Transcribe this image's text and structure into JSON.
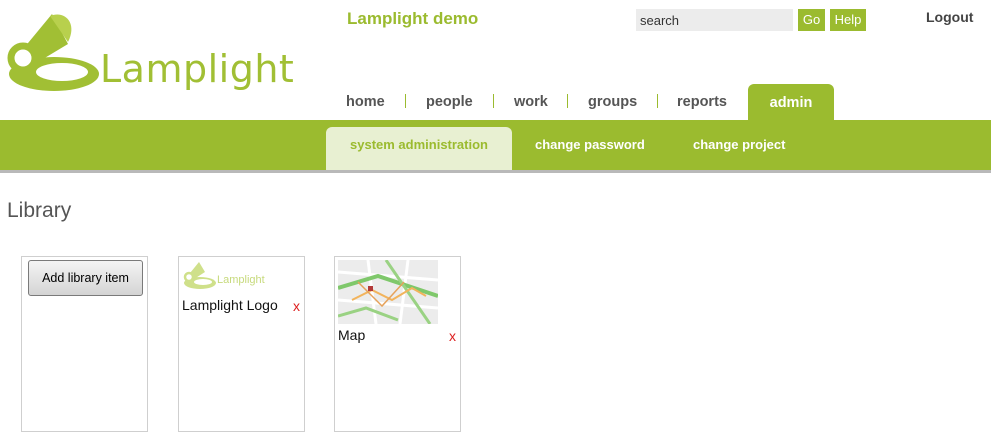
{
  "header": {
    "logo_text": "Lamplight",
    "app_title": "Lamplight demo",
    "search": {
      "placeholder": "search",
      "go_label": "Go"
    },
    "help_label": "Help",
    "logout_label": "Logout",
    "brand_color": "#9bbb2f"
  },
  "nav": {
    "items": [
      {
        "label": "home"
      },
      {
        "label": "people"
      },
      {
        "label": "work"
      },
      {
        "label": "groups"
      },
      {
        "label": "reports"
      },
      {
        "label": "admin",
        "active": true
      }
    ]
  },
  "subnav": {
    "items": [
      {
        "label": "system administration",
        "active": true
      },
      {
        "label": "change password"
      },
      {
        "label": "change project"
      }
    ]
  },
  "page": {
    "title": "Library"
  },
  "library": {
    "add_label": "Add library item",
    "items": [
      {
        "label": "Lamplight Logo",
        "thumb": "lamplight-logo-thumbnail",
        "thumb_text": "Lamplight",
        "delete_label": "x"
      },
      {
        "label": "Map",
        "thumb": "map-thumbnail",
        "delete_label": "x"
      }
    ]
  }
}
